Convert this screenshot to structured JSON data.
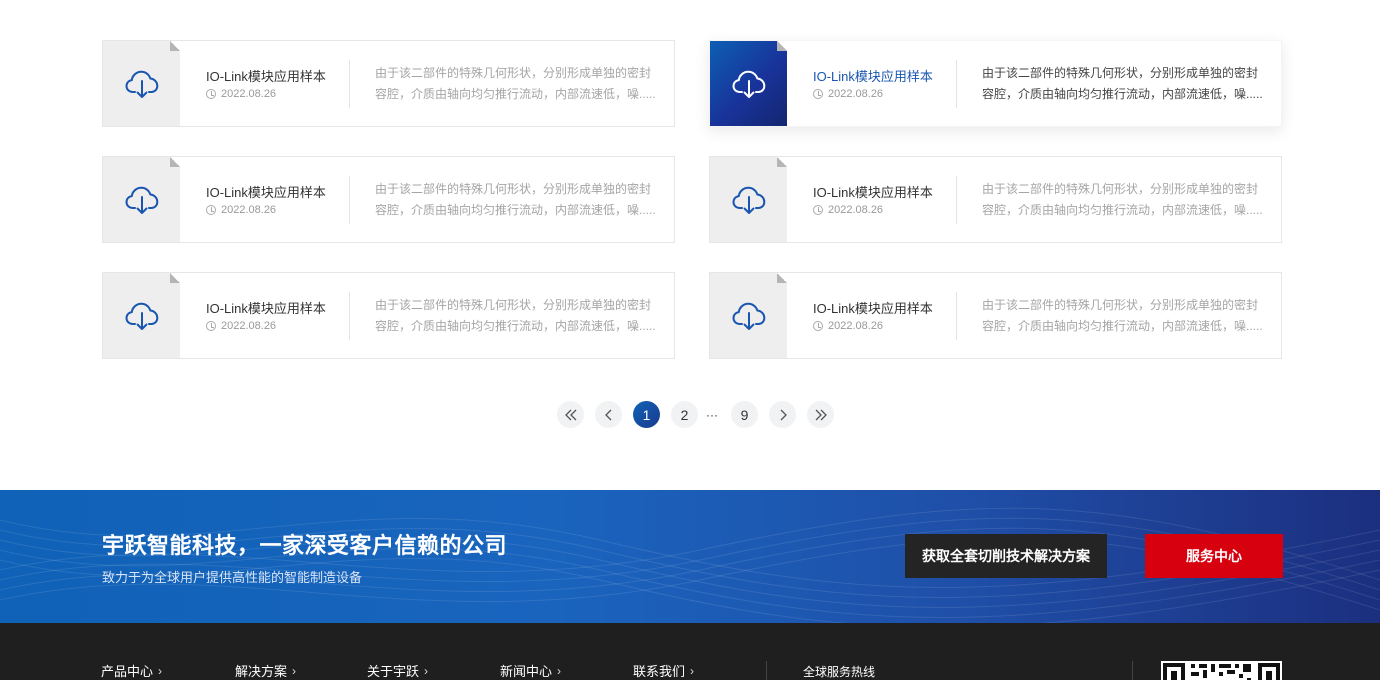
{
  "cards": [
    {
      "title": "IO-Link模块应用样本",
      "date": "2022.08.26",
      "desc": "由于该二部件的特殊几何形状，分别形成单独的密封容腔，介质由轴向均匀推行流动，内部流速低，噪.....",
      "active": false
    },
    {
      "title": "IO-Link模块应用样本",
      "date": "2022.08.26",
      "desc": "由于该二部件的特殊几何形状，分别形成单独的密封容腔，介质由轴向均匀推行流动，内部流速低，噪.....",
      "active": true
    },
    {
      "title": "IO-Link模块应用样本",
      "date": "2022.08.26",
      "desc": "由于该二部件的特殊几何形状，分别形成单独的密封容腔，介质由轴向均匀推行流动，内部流速低，噪.....",
      "active": false
    },
    {
      "title": "IO-Link模块应用样本",
      "date": "2022.08.26",
      "desc": "由于该二部件的特殊几何形状，分别形成单独的密封容腔，介质由轴向均匀推行流动，内部流速低，噪.....",
      "active": false
    },
    {
      "title": "IO-Link模块应用样本",
      "date": "2022.08.26",
      "desc": "由于该二部件的特殊几何形状，分别形成单独的密封容腔，介质由轴向均匀推行流动，内部流速低，噪.....",
      "active": false
    },
    {
      "title": "IO-Link模块应用样本",
      "date": "2022.08.26",
      "desc": "由于该二部件的特殊几何形状，分别形成单独的密封容腔，介质由轴向均匀推行流动，内部流速低，噪.....",
      "active": false
    }
  ],
  "card_icon": "cloud-download-icon",
  "date_icon": "clock-icon",
  "pagination": {
    "first_icon": "double-chevron-left-icon",
    "prev_icon": "chevron-left-icon",
    "pages": [
      "1",
      "2"
    ],
    "ellipsis": "···",
    "last_page": "9",
    "current": "1",
    "next_icon": "chevron-right-icon",
    "last_icon": "double-chevron-right-icon"
  },
  "banner": {
    "title": "宇跃智能科技，一家深受客户信赖的公司",
    "subtitle": "致力于为全球用户提供高性能的智能制造设备",
    "primary_button": "获取全套切削技术解决方案",
    "secondary_button": "服务中心"
  },
  "footer": {
    "nav": [
      {
        "label": "产品中心"
      },
      {
        "label": "解决方案"
      },
      {
        "label": "关于宇跃"
      },
      {
        "label": "新闻中心"
      },
      {
        "label": "联系我们"
      }
    ],
    "chevron": "›",
    "hotline_label": "全球服务热线",
    "qr_icon": "qr-code-icon"
  },
  "colors": {
    "accent_blue": "#1a56b0",
    "button_red": "#d7000f",
    "button_dark": "#242424",
    "footer_bg": "#1f1f1f"
  }
}
